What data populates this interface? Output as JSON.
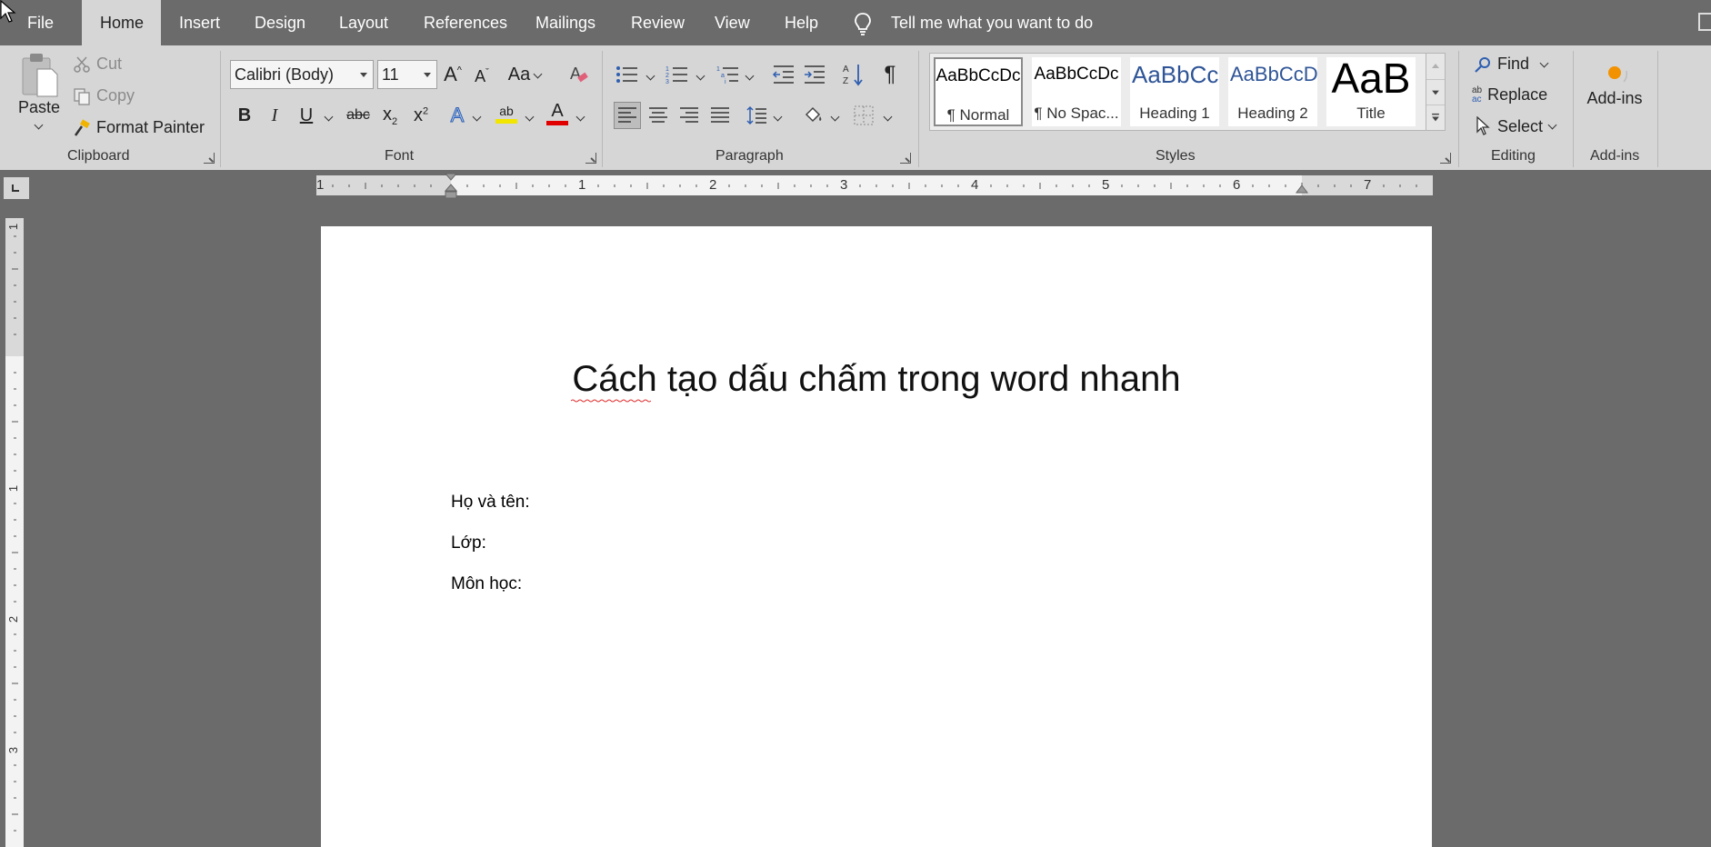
{
  "tabs": [
    {
      "id": "file",
      "label": "File"
    },
    {
      "id": "home",
      "label": "Home"
    },
    {
      "id": "insert",
      "label": "Insert"
    },
    {
      "id": "design",
      "label": "Design"
    },
    {
      "id": "layout",
      "label": "Layout"
    },
    {
      "id": "references",
      "label": "References"
    },
    {
      "id": "mailings",
      "label": "Mailings"
    },
    {
      "id": "review",
      "label": "Review"
    },
    {
      "id": "view",
      "label": "View"
    },
    {
      "id": "help",
      "label": "Help"
    }
  ],
  "active_tab": "Home",
  "tell_me": "Tell me what you want to do",
  "clipboard": {
    "label": "Clipboard",
    "paste": "Paste",
    "cut": "Cut",
    "copy": "Copy",
    "format_painter": "Format Painter"
  },
  "font": {
    "label": "Font",
    "font_name": "Calibri (Body)",
    "font_size": "11",
    "change_case": "Aa",
    "bold": "B",
    "italic": "I",
    "underline": "U",
    "strikethrough": "abc",
    "subscript": "x",
    "superscript": "x",
    "subscript_mark": "2",
    "superscript_mark": "2",
    "highlight_letters": "ab",
    "text_effects": "A",
    "font_color": "A",
    "highlight_color": "#f2e600",
    "font_color_value": "#e00000"
  },
  "paragraph": {
    "label": "Paragraph",
    "pilcrow": "¶"
  },
  "styles": {
    "label": "Styles",
    "items": [
      {
        "sample": "AaBbCcDc",
        "name": "¶ Normal",
        "selected": true
      },
      {
        "sample": "AaBbCcDc",
        "name": "¶ No Spac..."
      },
      {
        "sample": "AaBbCc",
        "name": "Heading 1"
      },
      {
        "sample": "AaBbCcD",
        "name": "Heading 2"
      },
      {
        "sample": "AaB",
        "name": "Title"
      }
    ],
    "heading_color": "#2f5597"
  },
  "editing": {
    "label": "Editing",
    "find": "Find",
    "replace": "Replace",
    "replace_icon_text": "ab",
    "replace_icon_text2": "ac",
    "select": "Select"
  },
  "addins": {
    "label": "Add-ins",
    "button": "Add-ins"
  },
  "ruler": {
    "numbers": [
      "1",
      "1",
      "2",
      "3",
      "4",
      "5",
      "6",
      "7"
    ],
    "vertical_numbers": [
      "1",
      "1",
      "2",
      "3"
    ]
  },
  "document": {
    "title": "Cách tạo dấu chấm trong word nhanh",
    "lines": [
      "Họ và tên:",
      "Lớp:",
      "Môn học:"
    ]
  }
}
